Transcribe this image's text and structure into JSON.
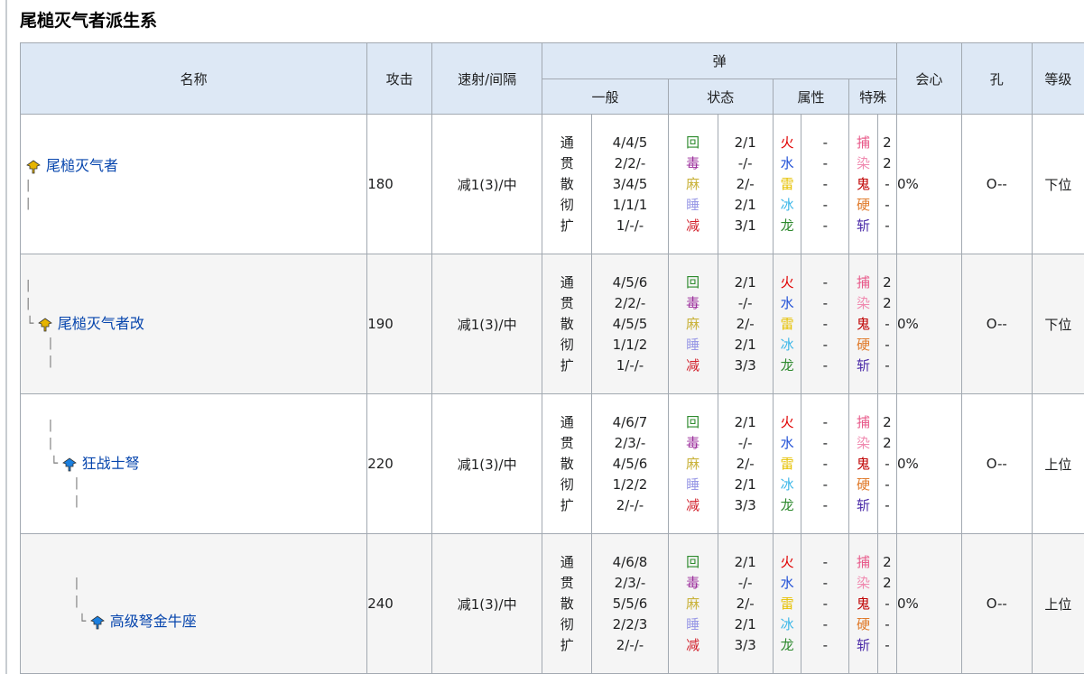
{
  "title": "尾槌灭气者派生系",
  "header": {
    "name": "名称",
    "attack": "攻击",
    "rate": "速射/间隔",
    "ammo": "弹",
    "crit": "会心",
    "slots": "孔",
    "rank": "等级",
    "general": "一般",
    "status": "状态",
    "element": "属性",
    "special": "特殊"
  },
  "colors": {
    "header_bg": "#dde8f5",
    "alt_row_bg": "#f5f5f5",
    "link": "#0645ad",
    "border": "#a2a9b1",
    "yellow_icon": "#e6b400",
    "blue_icon": "#1a7fe0"
  },
  "ammo_labels": {
    "general": [
      "通",
      "贯",
      "散",
      "彻",
      "扩"
    ],
    "status": [
      {
        "text": "回",
        "color": "#2e8b2e"
      },
      {
        "text": "毒",
        "color": "#9b2d9b"
      },
      {
        "text": "麻",
        "color": "#c9b23a"
      },
      {
        "text": "睡",
        "color": "#9a9ae6"
      },
      {
        "text": "减",
        "color": "#d2222d"
      }
    ],
    "element": [
      {
        "text": "火",
        "color": "#e00000"
      },
      {
        "text": "水",
        "color": "#1f4fd6"
      },
      {
        "text": "雷",
        "color": "#e6c100"
      },
      {
        "text": "冰",
        "color": "#39b6e8"
      },
      {
        "text": "龙",
        "color": "#2f8a2f"
      }
    ],
    "special": [
      {
        "text": "捕",
        "color": "#e85a8a"
      },
      {
        "text": "染",
        "color": "#f08ab0"
      },
      {
        "text": "鬼",
        "color": "#c00000"
      },
      {
        "text": "硬",
        "color": "#e07a2a"
      },
      {
        "text": "斩",
        "color": "#4a2aa8"
      }
    ]
  },
  "rows": [
    {
      "name": "尾槌灭气者",
      "icon": "yellow-weapon-icon",
      "attack": "180",
      "rate": "减1(3)/中",
      "general_values": [
        "4/4/5",
        "2/2/-",
        "3/4/5",
        "1/1/1",
        "1/-/-"
      ],
      "status_values": [
        "2/1",
        "-/-",
        "2/-",
        "2/1",
        "3/1"
      ],
      "element_values": [
        "-",
        "-",
        "-",
        "-",
        "-"
      ],
      "special_values": [
        "2",
        "2",
        "-",
        "-",
        "-"
      ],
      "crit": "0%",
      "slots": "O--",
      "rank": "下位",
      "pre_lines": [],
      "connector": "",
      "indent": "",
      "post_lines": [
        "|",
        "|"
      ]
    },
    {
      "name": "尾槌灭气者改",
      "icon": "yellow-weapon-icon",
      "attack": "190",
      "rate": "减1(3)/中",
      "general_values": [
        "4/5/6",
        "2/2/-",
        "4/5/5",
        "1/1/2",
        "1/-/-"
      ],
      "status_values": [
        "2/1",
        "-/-",
        "2/-",
        "2/1",
        "3/3"
      ],
      "element_values": [
        "-",
        "-",
        "-",
        "-",
        "-"
      ],
      "special_values": [
        "2",
        "2",
        "-",
        "-",
        "-"
      ],
      "crit": "0%",
      "slots": "O--",
      "rank": "下位",
      "pre_lines": [
        "|",
        "|"
      ],
      "connector": "└ ",
      "indent": "",
      "post_lines": [
        "      |",
        "      |"
      ]
    },
    {
      "name": "狂战士弩",
      "icon": "blue-weapon-icon",
      "attack": "220",
      "rate": "减1(3)/中",
      "general_values": [
        "4/6/7",
        "2/3/-",
        "4/5/6",
        "1/2/2",
        "2/-/-"
      ],
      "status_values": [
        "2/1",
        "-/-",
        "2/-",
        "2/1",
        "3/3"
      ],
      "element_values": [
        "-",
        "-",
        "-",
        "-",
        "-"
      ],
      "special_values": [
        "2",
        "2",
        "-",
        "-",
        "-"
      ],
      "crit": "0%",
      "slots": "O--",
      "rank": "上位",
      "pre_lines": [
        "      |",
        "      |"
      ],
      "connector": "└ ",
      "indent": "      ",
      "post_lines": [
        "             |",
        "             |"
      ]
    },
    {
      "name": "高级弩金牛座",
      "icon": "blue-weapon-icon",
      "attack": "240",
      "rate": "减1(3)/中",
      "general_values": [
        "4/6/8",
        "2/3/-",
        "5/5/6",
        "2/2/3",
        "2/-/-"
      ],
      "status_values": [
        "2/1",
        "-/-",
        "2/-",
        "2/1",
        "3/3"
      ],
      "element_values": [
        "-",
        "-",
        "-",
        "-",
        "-"
      ],
      "special_values": [
        "2",
        "2",
        "-",
        "-",
        "-"
      ],
      "crit": "0%",
      "slots": "O--",
      "rank": "上位",
      "pre_lines": [
        "             |",
        "             |"
      ],
      "connector": "└ ",
      "indent": "             ",
      "post_lines": []
    }
  ]
}
